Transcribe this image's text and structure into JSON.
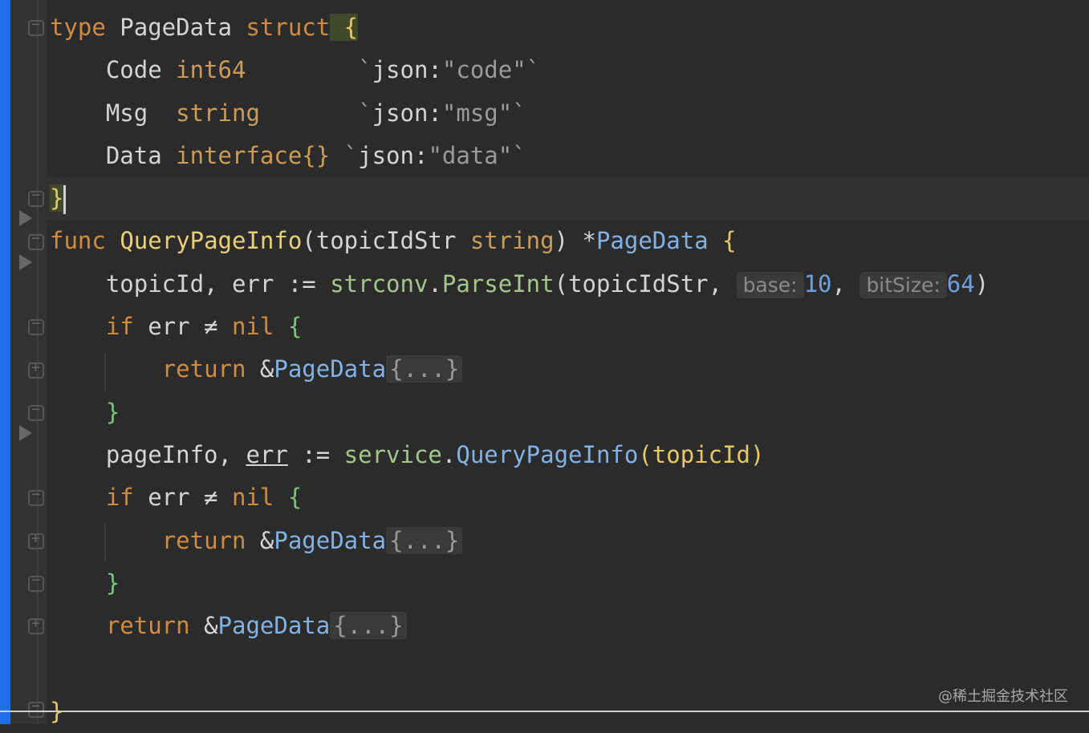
{
  "editor": {
    "accent": "#1f6feb",
    "background": "#2b2b2b",
    "lines": {
      "l1": {
        "t1": "type",
        "t2": " PageData ",
        "t3": "struct",
        "t4": " {"
      },
      "l2": {
        "t1": "    Code ",
        "t2": "int64",
        "t3": "        `",
        "t4": "json:",
        "t5": "\"code\"",
        "t6": "`"
      },
      "l3": {
        "t1": "    Msg  ",
        "t2": "string",
        "t3": "       `",
        "t4": "json:",
        "t5": "\"msg\"",
        "t6": "`"
      },
      "l4": {
        "t1": "    Data ",
        "t2": "interface{}",
        "t3": " `",
        "t4": "json:",
        "t5": "\"data\"",
        "t6": "`"
      },
      "l5": {
        "t1": "}"
      },
      "l6": {
        "t1": "func ",
        "t2": "QueryPageInfo",
        "t3": "(topicIdStr ",
        "t4": "string",
        "t5": ") *",
        "t6": "PageData",
        "t7": " {"
      },
      "l7": {
        "t1": "    topicId, err := ",
        "t2": "strconv",
        "t3": ".",
        "t4": "ParseInt",
        "t5": "(topicIdStr, ",
        "h1": "base:",
        "n1": "10",
        "t6": ", ",
        "h2": "bitSize:",
        "n2": "64",
        "t7": ")"
      },
      "l8": {
        "t1": "    ",
        "t2": "if",
        "t3": " err ≠ ",
        "t4": "nil",
        "t5": " {"
      },
      "l9": {
        "t1": "        ",
        "t2": "return",
        "t3": " &",
        "t4": "PageData",
        "t5": "{...}"
      },
      "l10": {
        "t1": "    }"
      },
      "l11": {
        "t1": "    pageInfo, ",
        "t2": "err",
        "t3": " := ",
        "t4": "service",
        "t5": ".",
        "t6": "QueryPageInfo",
        "t7": "(topicId)"
      },
      "l12": {
        "t1": "    ",
        "t2": "if",
        "t3": " err ≠ ",
        "t4": "nil",
        "t5": " {"
      },
      "l13": {
        "t1": "        ",
        "t2": "return",
        "t3": " &",
        "t4": "PageData",
        "t5": "{...}"
      },
      "l14": {
        "t1": "    }"
      },
      "l15": {
        "t1": "    ",
        "t2": "return",
        "t3": " &",
        "t4": "PageData",
        "t5": "{...}"
      },
      "l16": {
        "t1": ""
      },
      "l17": {
        "t1": "}"
      }
    }
  },
  "watermark": "@稀土掘金技术社区"
}
